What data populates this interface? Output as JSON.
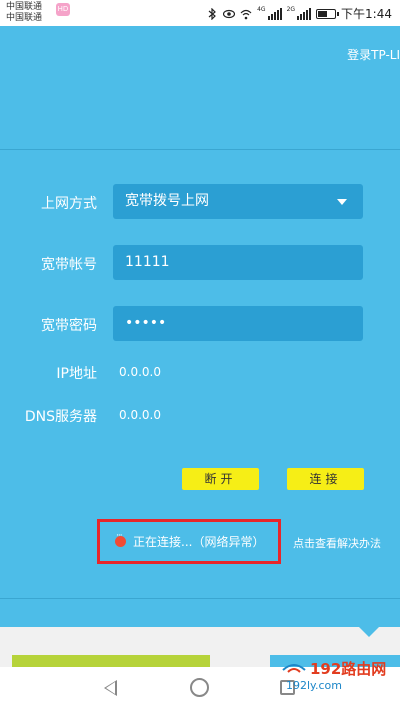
{
  "status_bar": {
    "carrier_1": "中国联通",
    "carrier_2": "中国联通",
    "carrier_badge": "HD",
    "network_1": "4G",
    "network_2": "2G",
    "time": "下午1:44",
    "battery_level": 0.55,
    "icons": [
      "bluetooth-icon",
      "eye-icon",
      "wifi-icon",
      "signal-icon",
      "battery-icon"
    ]
  },
  "header": {
    "login_link": "登录TP-LI"
  },
  "form": {
    "method": {
      "label": "上网方式",
      "value": "宽带拨号上网"
    },
    "account": {
      "label": "宽带帐号",
      "value": "11111"
    },
    "password": {
      "label": "宽带密码",
      "value": "•••••"
    },
    "ip": {
      "label": "IP地址",
      "value": "0.0.0.0"
    },
    "dns": {
      "label": "DNS服务器",
      "value": "0.0.0.0"
    }
  },
  "buttons": {
    "disconnect": "断开",
    "connect": "连接"
  },
  "connection_status": {
    "text": "正在连接...（网络异常）",
    "help_link": "点击查看解决办法"
  },
  "watermark": {
    "main": "192路由网",
    "sub": "192ly.com"
  },
  "colors": {
    "background": "#4dbde8",
    "field": "#2b9fd3",
    "button": "#f6ee16",
    "highlight_box": "#e8262a"
  }
}
